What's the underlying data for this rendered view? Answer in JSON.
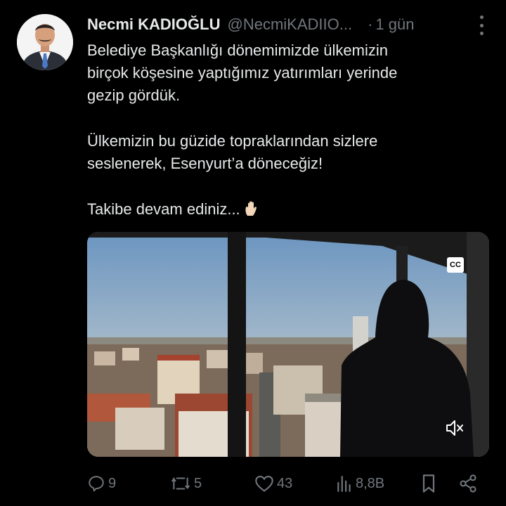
{
  "tweet": {
    "author_name": "Necmi KADIOĞLU",
    "author_handle": "@NecmiKADIIO...",
    "separator": "·",
    "time": "1 gün",
    "paragraph1_line1": "Belediye Başkanlığı dönemimizde ülkemizin",
    "paragraph1_line2": "birçok köşesine yaptığımız yatırımları yerinde",
    "paragraph1_line3": "gezip gördük.",
    "paragraph2_line1": "Ülkemizin bu güzide topraklarından sizlere",
    "paragraph2_line2": "seslenerek, Esenyurt’a döneceğiz!",
    "paragraph3": "Takibe devam ediniz...",
    "emoji_icon": "raised-hand-icon"
  },
  "media": {
    "cc_label": "CC",
    "mute_icon": "volume-muted-icon"
  },
  "actions": {
    "replies": "9",
    "retweets": "5",
    "likes": "43",
    "views": "8,8B"
  },
  "colors": {
    "background": "#000000",
    "text": "#e7e9ea",
    "secondary": "#71767b"
  }
}
